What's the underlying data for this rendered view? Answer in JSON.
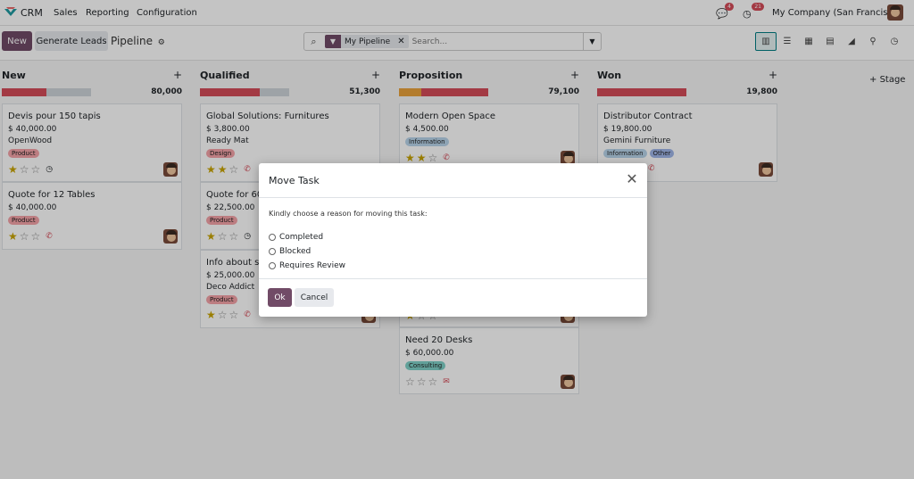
{
  "navbar": {
    "app_name": "CRM",
    "menus": [
      "Sales",
      "Reporting",
      "Configuration"
    ],
    "messages_count": "4",
    "activities_count": "21",
    "company": "My Company (San Francisco)"
  },
  "control_panel": {
    "new_label": "New",
    "generate_leads_label": "Generate Leads",
    "breadcrumb": "Pipeline",
    "facet_label": "My Pipeline",
    "search_placeholder": "Search...",
    "views": [
      "kanban-icon",
      "list-icon",
      "calendar-icon",
      "pivot-icon",
      "graph-icon",
      "map-icon",
      "activity-icon"
    ]
  },
  "kanban": {
    "add_stage_label": "Stage",
    "columns": [
      {
        "title": "New",
        "total": "80,000",
        "cards": [
          {
            "title": "Devis pour 150 tapis",
            "amount": "$ 40,000.00",
            "company": "OpenWood",
            "tags": [
              "Product"
            ],
            "stars": 1,
            "activity": "clock"
          },
          {
            "title": "Quote for 12 Tables",
            "amount": "$ 40,000.00",
            "company": "",
            "tags": [
              "Product"
            ],
            "stars": 1,
            "activity": "phone"
          }
        ]
      },
      {
        "title": "Qualified",
        "total": "51,300",
        "cards": [
          {
            "title": "Global Solutions: Furnitures",
            "amount": "$ 3,800.00",
            "company": "Ready Mat",
            "tags": [
              "Design"
            ],
            "stars": 2,
            "activity": "phone"
          },
          {
            "title": "Quote for 60",
            "amount": "$ 22,500.00",
            "company": "",
            "tags": [
              "Product"
            ],
            "stars": 1,
            "activity": "clock"
          },
          {
            "title": "Info about se",
            "amount": "$ 25,000.00",
            "company": "Deco Addict",
            "tags": [
              "Product"
            ],
            "stars": 1,
            "activity": "phone"
          }
        ]
      },
      {
        "title": "Proposition",
        "total": "79,100",
        "cards": [
          {
            "title": "Modern Open Space",
            "amount": "$ 4,500.00",
            "company": "",
            "tags": [
              "Information"
            ],
            "stars": 2,
            "activity": "phone"
          },
          {
            "title": "Need 20 Desks",
            "amount": "$ 60,000.00",
            "company": "",
            "tags": [
              "Consulting"
            ],
            "stars": 0,
            "activity": "mail"
          }
        ]
      },
      {
        "title": "Won",
        "total": "19,800",
        "cards": [
          {
            "title": "Distributor Contract",
            "amount": "$ 19,800.00",
            "company": "Gemini Furniture",
            "tags": [
              "Information",
              "Other"
            ],
            "stars": 0,
            "activity": "phone"
          }
        ]
      }
    ]
  },
  "tag_colors": {
    "Product": "#f5a3a8",
    "Design": "#f5a3a8",
    "Information": "#b8d4ea",
    "Consulting": "#7fd1c7",
    "Other": "#9fb5e8"
  },
  "colors": {
    "brand": "#714b67",
    "bar_red": "#d44c59",
    "bar_orange": "#e9a23b",
    "bar_grey": "#ced4da"
  },
  "modal": {
    "title": "Move Task",
    "prompt": "Kindly choose a reason for moving this task:",
    "options": [
      "Completed",
      "Blocked",
      "Requires Review"
    ],
    "ok_label": "Ok",
    "cancel_label": "Cancel"
  }
}
